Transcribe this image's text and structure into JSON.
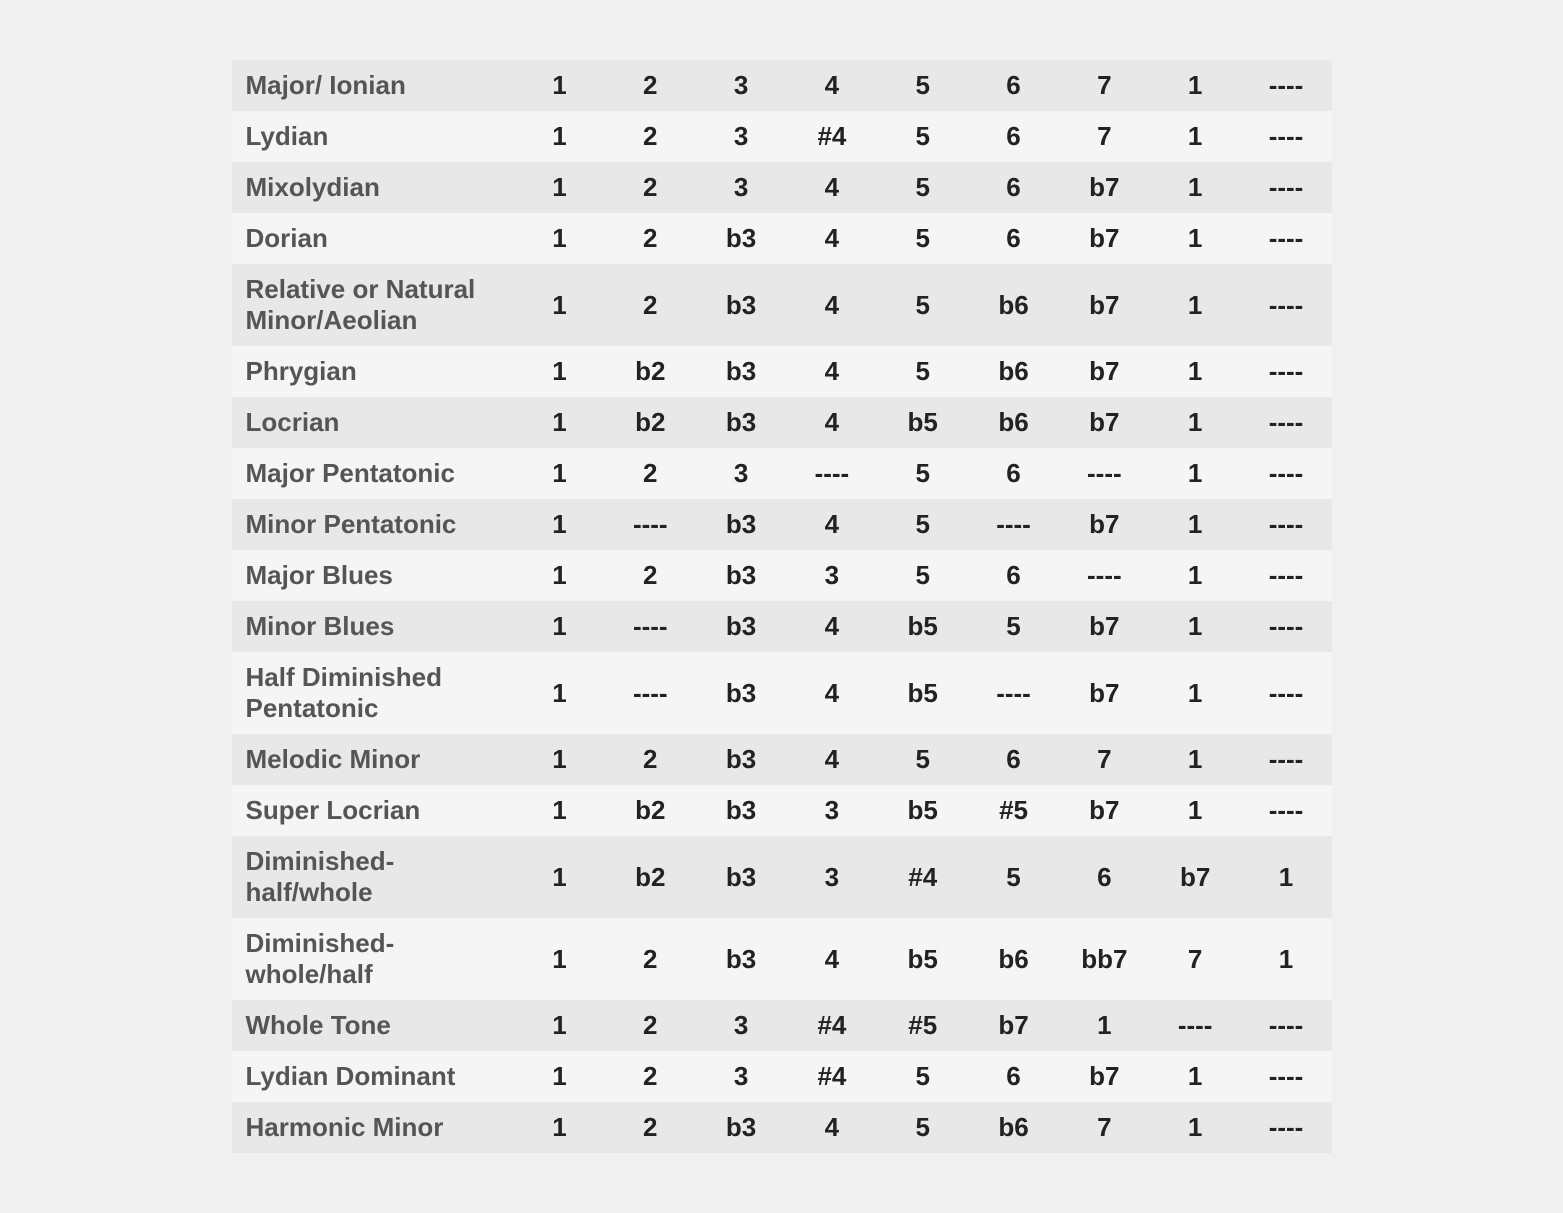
{
  "table": {
    "rows": [
      {
        "name": "Major/ Ionian",
        "values": [
          "1",
          "2",
          "3",
          "4",
          "5",
          "6",
          "7",
          "1",
          "----"
        ]
      },
      {
        "name": "Lydian",
        "values": [
          "1",
          "2",
          "3",
          "#4",
          "5",
          "6",
          "7",
          "1",
          "----"
        ]
      },
      {
        "name": "Mixolydian",
        "values": [
          "1",
          "2",
          "3",
          "4",
          "5",
          "6",
          "b7",
          "1",
          "----"
        ]
      },
      {
        "name": "Dorian",
        "values": [
          "1",
          "2",
          "b3",
          "4",
          "5",
          "6",
          "b7",
          "1",
          "----"
        ]
      },
      {
        "name": "Relative or Natural\nMinor/Aeolian",
        "values": [
          "1",
          "2",
          "b3",
          "4",
          "5",
          "b6",
          "b7",
          "1",
          "----"
        ]
      },
      {
        "name": "Phrygian",
        "values": [
          "1",
          "b2",
          "b3",
          "4",
          "5",
          "b6",
          "b7",
          "1",
          "----"
        ]
      },
      {
        "name": "Locrian",
        "values": [
          "1",
          "b2",
          "b3",
          "4",
          "b5",
          "b6",
          "b7",
          "1",
          "----"
        ]
      },
      {
        "name": "Major Pentatonic",
        "values": [
          "1",
          "2",
          "3",
          "----",
          "5",
          "6",
          "----",
          "1",
          "----"
        ]
      },
      {
        "name": "Minor Pentatonic",
        "values": [
          "1",
          "----",
          "b3",
          "4",
          "5",
          "----",
          "b7",
          "1",
          "----"
        ]
      },
      {
        "name": "Major Blues",
        "values": [
          "1",
          "2",
          "b3",
          "3",
          "5",
          "6",
          "----",
          "1",
          "----"
        ]
      },
      {
        "name": "Minor Blues",
        "values": [
          "1",
          "----",
          "b3",
          "4",
          "b5",
          "5",
          "b7",
          "1",
          "----"
        ]
      },
      {
        "name": "Half Diminished\nPentatonic",
        "values": [
          "1",
          "----",
          "b3",
          "4",
          "b5",
          "----",
          "b7",
          "1",
          "----"
        ]
      },
      {
        "name": "Melodic Minor",
        "values": [
          "1",
          "2",
          "b3",
          "4",
          "5",
          "6",
          "7",
          "1",
          "----"
        ]
      },
      {
        "name": "Super Locrian",
        "values": [
          "1",
          "b2",
          "b3",
          "3",
          "b5",
          "#5",
          "b7",
          "1",
          "----"
        ]
      },
      {
        "name": "Diminished- half/whole",
        "values": [
          "1",
          "b2",
          "b3",
          "3",
          "#4",
          "5",
          "6",
          "b7",
          "1"
        ]
      },
      {
        "name": "Diminished- whole/half",
        "values": [
          "1",
          "2",
          "b3",
          "4",
          "b5",
          "b6",
          "bb7",
          "7",
          "1"
        ]
      },
      {
        "name": "Whole Tone",
        "values": [
          "1",
          "2",
          "3",
          "#4",
          "#5",
          "b7",
          "1",
          "----",
          "----"
        ]
      },
      {
        "name": "Lydian Dominant",
        "values": [
          "1",
          "2",
          "3",
          "#4",
          "5",
          "6",
          "b7",
          "1",
          "----"
        ]
      },
      {
        "name": "Harmonic Minor",
        "values": [
          "1",
          "2",
          "b3",
          "4",
          "5",
          "b6",
          "7",
          "1",
          "----"
        ]
      }
    ]
  }
}
